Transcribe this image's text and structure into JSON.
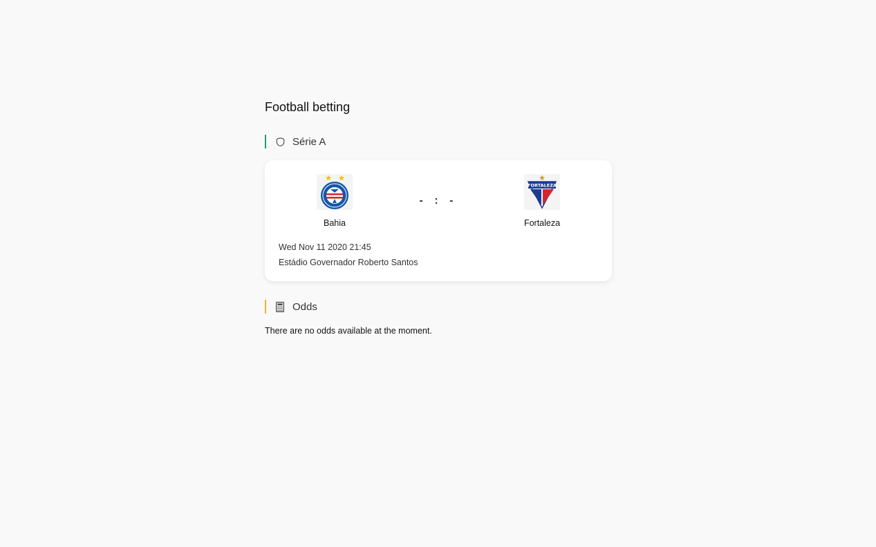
{
  "page": {
    "title": "Football betting"
  },
  "league": {
    "name": "Série A",
    "accent": "#1e9e6a",
    "icon": "shield-icon"
  },
  "match": {
    "home": {
      "name": "Bahia",
      "logo": "bahia-crest-icon"
    },
    "away": {
      "name": "Fortaleza",
      "logo": "fortaleza-crest-icon"
    },
    "score_home": "-",
    "score_separator": ":",
    "score_away": "-",
    "datetime": "Wed Nov 11 2020 21:45",
    "venue": "Estádio Governador Roberto Santos"
  },
  "odds": {
    "title": "Odds",
    "accent": "#f0b429",
    "icon": "calculator-icon",
    "empty_message": "There are no odds available at the moment."
  }
}
